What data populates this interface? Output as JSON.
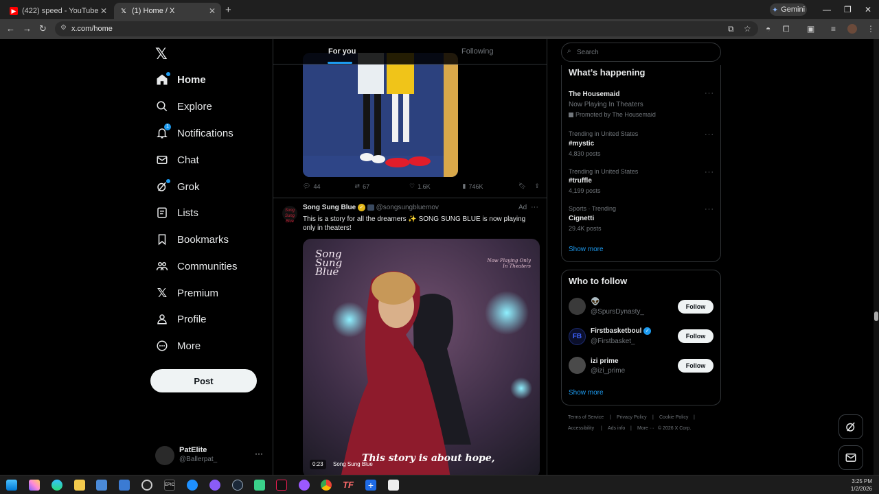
{
  "browser": {
    "tabs": [
      {
        "title": "(422) speed - YouTube",
        "icon": "youtube-icon"
      },
      {
        "title": "(1) Home / X",
        "icon": "x-logo-icon"
      }
    ],
    "gemini_label": "Gemini",
    "url": "x.com/home"
  },
  "sidebar": {
    "items": [
      {
        "label": "Home",
        "icon": "home-icon"
      },
      {
        "label": "Explore",
        "icon": "search-icon"
      },
      {
        "label": "Notifications",
        "icon": "bell-icon",
        "badge": "1"
      },
      {
        "label": "Chat",
        "icon": "mail-icon"
      },
      {
        "label": "Grok",
        "icon": "grok-icon"
      },
      {
        "label": "Lists",
        "icon": "list-icon"
      },
      {
        "label": "Bookmarks",
        "icon": "bookmark-icon"
      },
      {
        "label": "Communities",
        "icon": "communities-icon"
      },
      {
        "label": "Premium",
        "icon": "x-logo-icon"
      },
      {
        "label": "Profile",
        "icon": "person-icon"
      },
      {
        "label": "More",
        "icon": "more-circle-icon"
      }
    ],
    "post_label": "Post",
    "account": {
      "name": "PatElite",
      "handle": "@Ballerpat_"
    }
  },
  "feed": {
    "tabs": {
      "for_you": "For you",
      "following": "Following"
    },
    "prev_post_metrics": {
      "replies": "44",
      "reposts": "67",
      "likes": "1.6K",
      "views": "746K"
    },
    "ad_post": {
      "name": "Song Sung Blue",
      "handle": "@songsungbluemov",
      "ad_label": "Ad",
      "text": "This is a story for all the dreamers ✨ SONG SUNG BLUE is now playing only in theaters!",
      "video": {
        "logo": "Song Sung Blue",
        "corner_text": "Now Playing Only In Theaters",
        "caption": "This story is about hope,",
        "time": "0:23",
        "title": "Song Sung Blue"
      }
    }
  },
  "right": {
    "search_placeholder": "Search",
    "happening_title": "What’s happening",
    "trends": [
      {
        "name": "The Housemaid",
        "sub": "Now Playing In Theaters",
        "promo": "Promoted by The Housemaid"
      },
      {
        "meta": "Trending in United States",
        "name": "#mystic",
        "posts": "4,830 posts"
      },
      {
        "meta": "Trending in United States",
        "name": "#truffle",
        "posts": "4,199 posts"
      },
      {
        "meta": "Sports · Trending",
        "name": "Cignetti",
        "posts": "29.4K posts"
      }
    ],
    "show_more": "Show more",
    "who_to_follow_title": "Who to follow",
    "suggestions": [
      {
        "name": "👽",
        "handle": "@SpursDynasty_",
        "button": "Follow"
      },
      {
        "name": "Firstbasketboul",
        "handle": "@Firstbasket_",
        "button": "Follow"
      },
      {
        "name": "izi prime",
        "handle": "@izi_prime",
        "button": "Follow"
      }
    ],
    "footer": [
      "Terms of Service",
      "Privacy Policy",
      "Cookie Policy",
      "Accessibility",
      "Ads info",
      "More ···",
      "© 2026 X Corp."
    ]
  },
  "taskbar": {
    "time": "3:25 PM",
    "date": "1/2/2026"
  },
  "colors": {
    "accent": "#1d9bf0",
    "bg": "#000000",
    "text": "#e7e9ea",
    "muted": "#71767b",
    "border": "#2f3336"
  }
}
